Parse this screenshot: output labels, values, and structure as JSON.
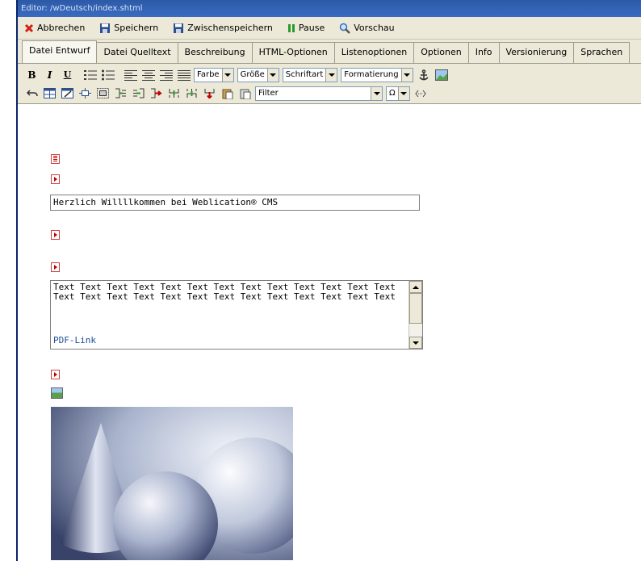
{
  "window": {
    "title": "Editor: /wDeutsch/index.shtml"
  },
  "actions": {
    "cancel": "Abbrechen",
    "save": "Speichern",
    "save_temp": "Zwischenspeichern",
    "pause": "Pause",
    "preview": "Vorschau"
  },
  "tabs": [
    {
      "label": "Datei Entwurf",
      "active": true
    },
    {
      "label": "Datei Quelltext"
    },
    {
      "label": "Beschreibung"
    },
    {
      "label": "HTML-Optionen"
    },
    {
      "label": "Listenoptionen"
    },
    {
      "label": "Optionen"
    },
    {
      "label": "Info"
    },
    {
      "label": "Versionierung"
    },
    {
      "label": "Sprachen"
    }
  ],
  "toolbar": {
    "bold": "B",
    "italic": "I",
    "underline": "U",
    "color_select": "Farbe",
    "size_select": "Größe",
    "font_select": "Schriftart",
    "format_select": "Formatierung",
    "filter_select": "Filter",
    "symbol_select": "Ω"
  },
  "content": {
    "title_value": "Herzlich Willllkommen bei Weblication® CMS",
    "body_text": "Text Text Text Text Text Text Text Text Text Text Text Text Text\nText Text Text Text Text Text Text Text Text Text Text Text Text",
    "pdf_link": "PDF-Link"
  },
  "colors": {
    "titlebar": "#3a6bc0",
    "chrome": "#ece9d8",
    "link": "#1a4e9a",
    "cancel_icon": "#d0201a",
    "pause_icon": "#2a9a2a"
  }
}
